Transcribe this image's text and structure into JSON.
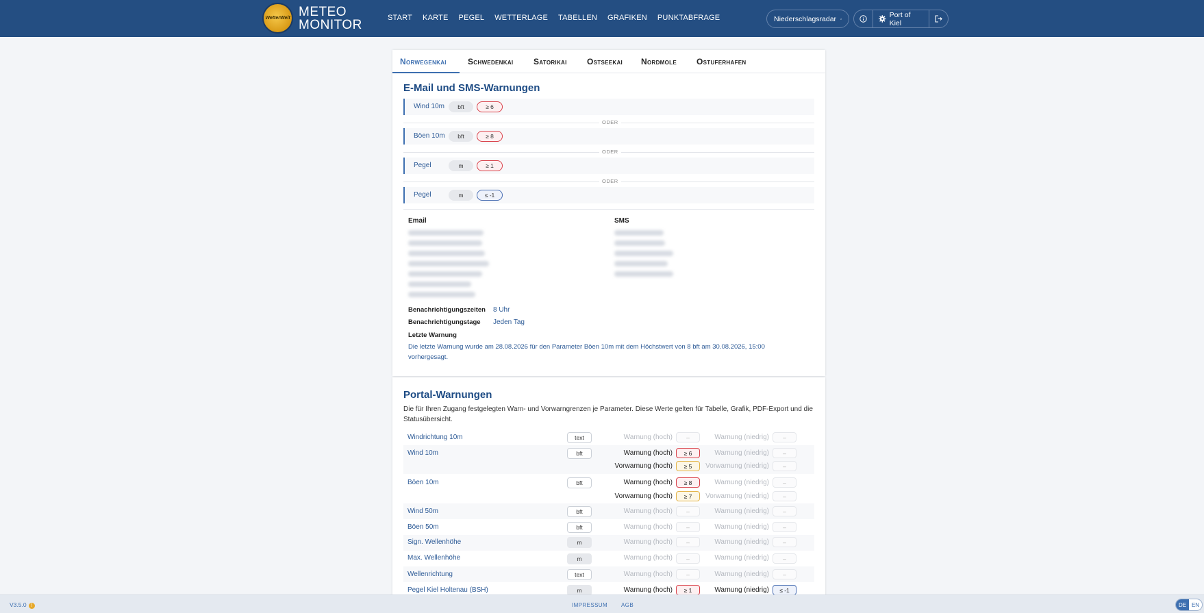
{
  "header": {
    "logo_text": "WetterWelt",
    "brand_line1": "METEO",
    "brand_line2": "MONITOR",
    "nav": [
      "START",
      "KARTE",
      "PEGEL",
      "WETTERLAGE",
      "TABELLEN",
      "GRAFIKEN",
      "PUNKTABFRAGE"
    ],
    "radar_label": "Niederschlagsradar",
    "account_label": "Port of Kiel"
  },
  "tabs": [
    "Norwegenkai",
    "Schwedenkai",
    "Satorikai",
    "Ostseekai",
    "Nordmole",
    "Ostuferhafen"
  ],
  "email_sms": {
    "title": "E-Mail und SMS-Warnungen",
    "or_label": "ODER",
    "rules": [
      {
        "label": "Wind 10m",
        "unit": "bft",
        "threshold": "≥ 6",
        "kind": "high"
      },
      {
        "label": "Böen 10m",
        "unit": "bft",
        "threshold": "≥ 8",
        "kind": "high"
      },
      {
        "label": "Pegel",
        "unit": "m",
        "threshold": "≥ 1",
        "kind": "high"
      },
      {
        "label": "Pegel",
        "unit": "m",
        "threshold": "≤ -1",
        "kind": "low"
      }
    ],
    "email_label": "Email",
    "sms_label": "SMS",
    "times_label": "Benachrichtigungszeiten",
    "times_value": "8 Uhr",
    "days_label": "Benachrichtigungstage",
    "days_value": "Jeden Tag",
    "last_label": "Letzte Warnung",
    "last_text": "Die letzte Warnung wurde am 28.08.2026 für den Parameter Böen 10m mit dem Höchstwert von 8 bft am 30.08.2026, 15:00 vorhergesagt."
  },
  "portal": {
    "title": "Portal-Warnungen",
    "description": "Die für Ihren Zugang festgelegten Warn- und Vorwarngrenzen je Parameter. Diese Werte gelten für Tabelle, Grafik, PDF-Export und die Statusübersicht.",
    "labels": {
      "warn_high": "Warnung (hoch)",
      "warn_low": "Warnung (niedrig)",
      "pre_high": "Vorwarnung (hoch)",
      "pre_low": "Vorwarnung (niedrig)",
      "dash": "–"
    },
    "rows": [
      {
        "name": "Windrichtung 10m",
        "unit": "text"
      },
      {
        "name": "Wind 10m",
        "unit": "bft",
        "warn_high": "≥ 6",
        "pre_high": "≥ 5"
      },
      {
        "name": "Böen 10m",
        "unit": "bft",
        "warn_high": "≥ 8",
        "pre_high": "≥ 7"
      },
      {
        "name": "Wind 50m",
        "unit": "bft"
      },
      {
        "name": "Böen 50m",
        "unit": "bft"
      },
      {
        "name": "Sign. Wellenhöhe",
        "unit": "m"
      },
      {
        "name": "Max. Wellenhöhe",
        "unit": "m"
      },
      {
        "name": "Wellenrichtung",
        "unit": "text"
      },
      {
        "name": "Pegel Kiel Holtenau (BSH)",
        "unit": "m",
        "warn_high": "≥ 1",
        "warn_low": "≤ -1"
      }
    ]
  },
  "footer": {
    "version": "V3.5.0",
    "links": [
      "IMPRESSUM",
      "AGB"
    ],
    "lang": [
      "DE",
      "EN"
    ]
  }
}
